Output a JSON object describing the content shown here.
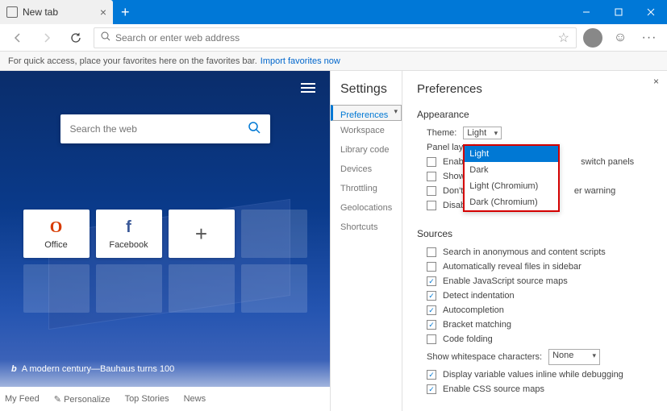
{
  "window": {
    "tab_title": "New tab"
  },
  "toolbar": {
    "address_placeholder": "Search or enter web address"
  },
  "favbar": {
    "text": "For quick access, place your favorites here on the favorites bar.",
    "link": "Import favorites now"
  },
  "ntp": {
    "search_placeholder": "Search the web",
    "tiles": [
      {
        "label": "Office",
        "icon": "office"
      },
      {
        "label": "Facebook",
        "icon": "fb"
      },
      {
        "label": "",
        "icon": "plus"
      }
    ],
    "caption": "A modern century—Bauhaus turns 100",
    "feed": {
      "myfeed": "My Feed",
      "personalize": "Personalize",
      "top": "Top Stories",
      "news": "News"
    }
  },
  "settings": {
    "title": "Settings",
    "nav": [
      "Preferences",
      "Workspace",
      "Library code",
      "Devices",
      "Throttling",
      "Geolocations",
      "Shortcuts"
    ],
    "selected": 0
  },
  "prefs": {
    "title": "Preferences",
    "appearance": {
      "title": "Appearance",
      "theme_label": "Theme:",
      "theme_value": "Light",
      "theme_options": [
        "Light",
        "Dark",
        "Light (Chromium)",
        "Dark (Chromium)"
      ],
      "panel_layout_label": "Panel layout:",
      "cb1": {
        "checked": false,
        "label_suffix": "switch panels",
        "label_prefix": "Enabl"
      },
      "cb2": {
        "checked": false,
        "label": "Show"
      },
      "cb3": {
        "checked": false,
        "label_prefix": "Don't",
        "label_suffix": "er warning"
      },
      "cb4": {
        "checked": false,
        "label": "Disable paused state overlay"
      }
    },
    "sources": {
      "title": "Sources",
      "items": [
        {
          "checked": false,
          "label": "Search in anonymous and content scripts"
        },
        {
          "checked": false,
          "label": "Automatically reveal files in sidebar"
        },
        {
          "checked": true,
          "label": "Enable JavaScript source maps"
        },
        {
          "checked": true,
          "label": "Detect indentation"
        },
        {
          "checked": true,
          "label": "Autocompletion"
        },
        {
          "checked": true,
          "label": "Bracket matching"
        },
        {
          "checked": false,
          "label": "Code folding"
        }
      ],
      "whitespace_label": "Show whitespace characters:",
      "whitespace_value": "None",
      "more": [
        {
          "checked": true,
          "label": "Display variable values inline while debugging"
        },
        {
          "checked": true,
          "label": "Enable CSS source maps"
        }
      ]
    }
  }
}
